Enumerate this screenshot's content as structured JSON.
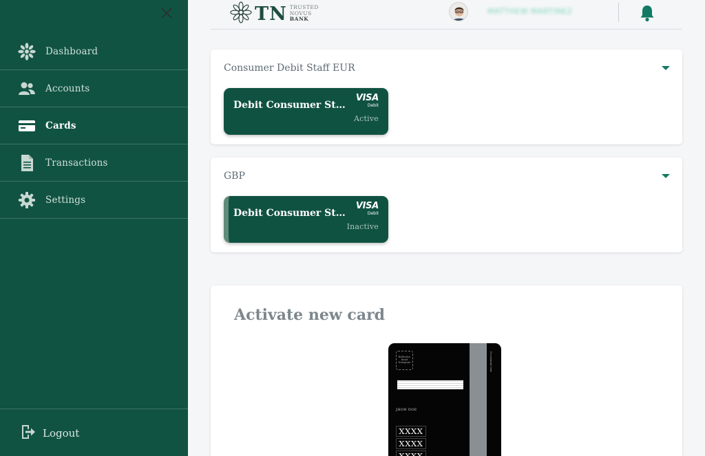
{
  "sidebar": {
    "items": [
      {
        "label": "Dashboard",
        "icon": "dashboard-icon"
      },
      {
        "label": "Accounts",
        "icon": "users-icon"
      },
      {
        "label": "Cards",
        "icon": "credit-card-icon",
        "active": true
      },
      {
        "label": "Transactions",
        "icon": "document-icon"
      },
      {
        "label": "Settings",
        "icon": "gear-icon"
      }
    ],
    "logout_label": "Logout"
  },
  "header": {
    "logo_letters": "TN",
    "logo_line1": "TRUSTED",
    "logo_line2": "NOVUS",
    "logo_line3": "BANK",
    "username": "MATTHEW MARTINEZ"
  },
  "panels": [
    {
      "title": "Consumer Debit Staff EUR",
      "card": {
        "name": "Debit Consumer Staff EUR",
        "brand": "VISA",
        "brand_sub": "Debit",
        "status": "Active"
      }
    },
    {
      "title": "GBP",
      "card": {
        "name": "Debit Consumer Staff GBP",
        "brand": "VISA",
        "brand_sub": "Debit",
        "status": "Inactive"
      }
    }
  ],
  "activate": {
    "title": "Activate new card",
    "card_image": {
      "holder": "JHON DOE",
      "hologram_text": "Reflective Band Hologram",
      "side_text": "Document text",
      "numbers": [
        "XXXX",
        "XXXX",
        "XXXX"
      ]
    }
  },
  "colors": {
    "brand_green": "#115343",
    "card_green": "#105242",
    "accent": "#127a63",
    "bell": "#127a63"
  }
}
